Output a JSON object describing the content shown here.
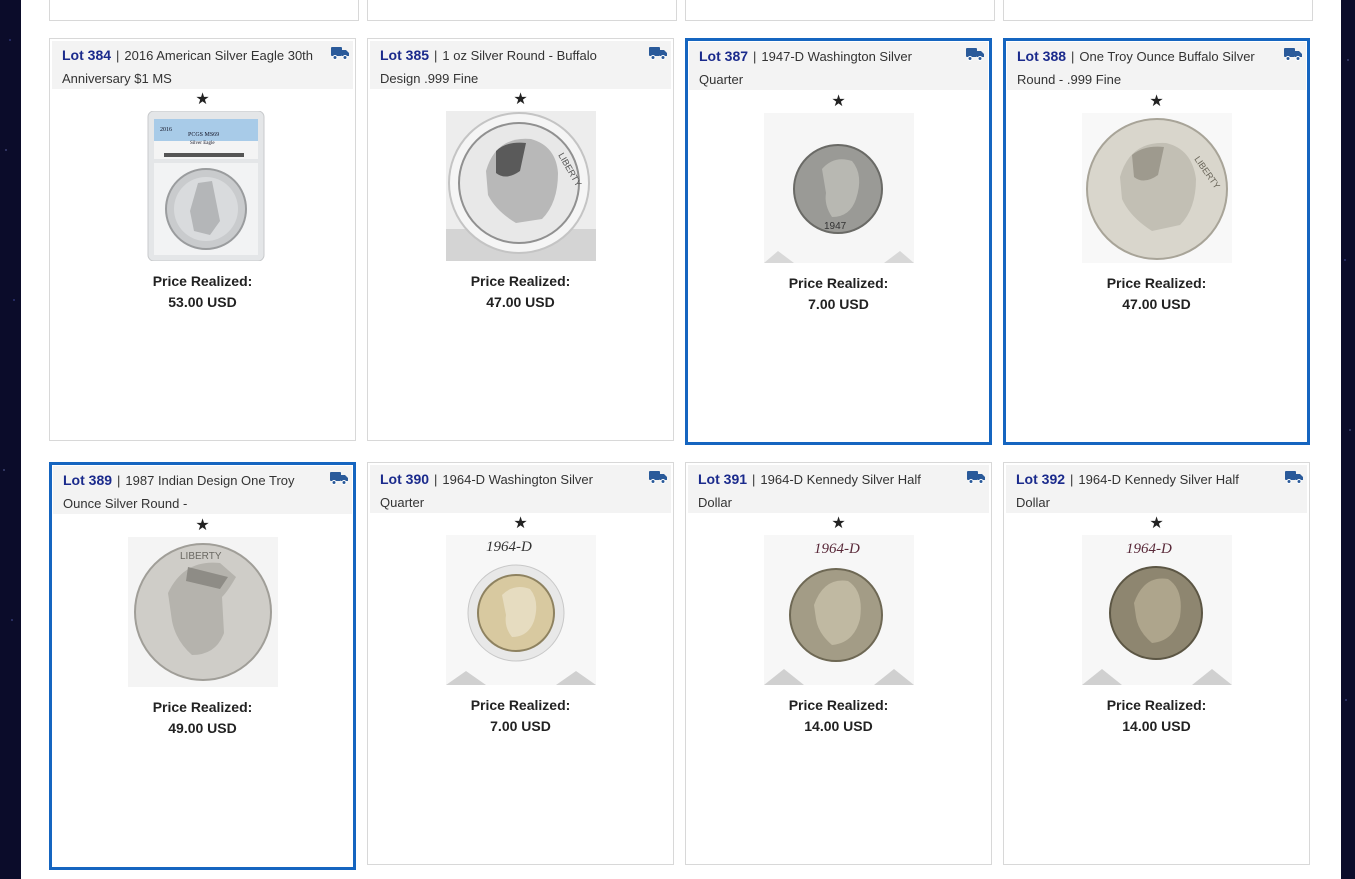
{
  "price_label": "Price Realized:",
  "lots": [
    {
      "lot": "Lot 384",
      "title": "2016 American Silver Eagle 30th Anniversary $1 MS",
      "price": "53.00 USD"
    },
    {
      "lot": "Lot 385",
      "title": "1 oz Silver Round - Buffalo Design .999 Fine",
      "price": "47.00 USD"
    },
    {
      "lot": "Lot 387",
      "title": "1947-D Washington Silver Quarter",
      "price": "7.00 USD"
    },
    {
      "lot": "Lot 388",
      "title": "One Troy Ounce Buffalo Silver Round - .999 Fine",
      "price": "47.00 USD"
    },
    {
      "lot": "Lot 389",
      "title": "1987 Indian Design One Troy Ounce Silver Round -",
      "price": "49.00 USD"
    },
    {
      "lot": "Lot 390",
      "title": "1964-D Washington Silver Quarter",
      "price": "7.00 USD"
    },
    {
      "lot": "Lot 391",
      "title": "1964-D Kennedy Silver Half Dollar",
      "price": "14.00 USD"
    },
    {
      "lot": "Lot 392",
      "title": "1964-D Kennedy Silver Half Dollar",
      "price": "14.00 USD"
    }
  ],
  "image_notes": {
    "slab_year": "2016",
    "slab_grade": "PCGS MS69",
    "slab_desc": "Silver Eagle",
    "coin_liberty": "LIBERTY",
    "quarter_year": "1947",
    "handwritten_year": "1964-D"
  },
  "colors": {
    "accent": "#1565c0",
    "lot_link": "#1a2a8c",
    "truck": "#2a5a9a"
  },
  "icons": {
    "truck": "shipping-truck-icon",
    "star": "favorite-star-icon"
  }
}
